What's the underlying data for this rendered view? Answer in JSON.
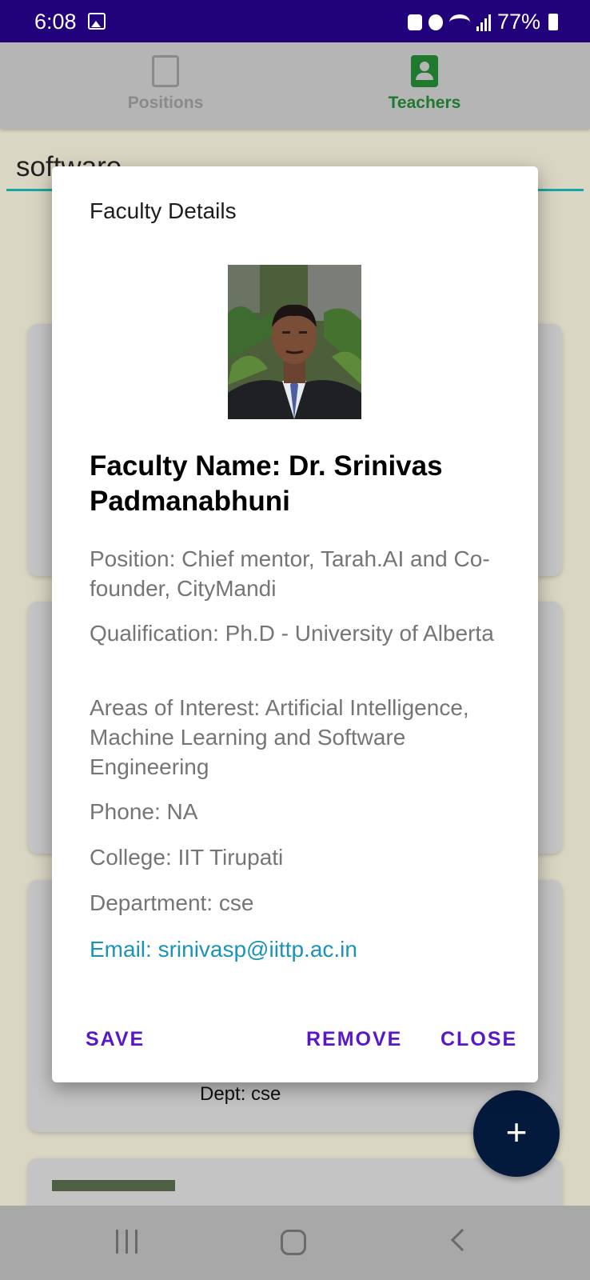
{
  "status_bar": {
    "time": "6:08",
    "battery": "77%"
  },
  "tabs": [
    {
      "label": "Positions",
      "icon": "clipboard-search-icon",
      "active": false
    },
    {
      "label": "Teachers",
      "icon": "teacher-badge-icon",
      "active": true
    }
  ],
  "search": {
    "value": "software"
  },
  "background_card": {
    "dept": "Dept: cse"
  },
  "fab": {
    "label": "+"
  },
  "dialog": {
    "title": "Faculty Details",
    "faculty_name": "Faculty Name: Dr. Srinivas Padmanabhuni",
    "position": "Position: Chief mentor, Tarah.AI and Co-founder, CityMandi",
    "qualification": "Qualification: Ph.D - University of Alberta",
    "areas": "Areas of Interest: Artificial Intelligence, Machine Learning and Software Engineering",
    "phone": "Phone: NA",
    "college": "College: IIT Tirupati",
    "department": "Department: cse",
    "email": "Email: srinivasp@iittp.ac.in",
    "buttons": {
      "save": "SAVE",
      "remove": "REMOVE",
      "close": "CLOSE"
    }
  },
  "colors": {
    "status_bar": "#22027a",
    "active_tab": "#1f7a2f",
    "accent_button": "#5a17c7",
    "email_link": "#1b93b8",
    "fab": "#041a3d"
  }
}
